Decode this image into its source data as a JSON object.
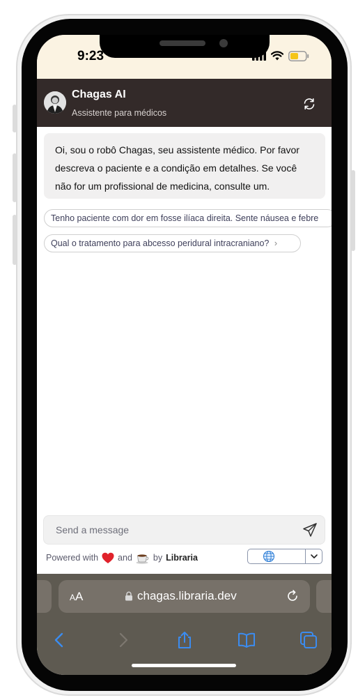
{
  "status_bar": {
    "time": "9:23"
  },
  "header": {
    "title": "Chagas AI",
    "subtitle": "Assistente para médicos"
  },
  "chat": {
    "bot_message_lines": [
      "Oi, sou o robô Chagas, seu assistente médico. Por favor",
      "descreva o paciente e a condição em detalhes. Se você",
      "não for um profissional de medicina, consulte um."
    ],
    "suggestions": [
      "Tenho paciente com dor em fosse ilíaca direita. Sente náusea e febre",
      "Qual o tratamento para abcesso peridural intracraniano?"
    ]
  },
  "composer": {
    "placeholder": "Send a message"
  },
  "footer": {
    "powered_prefix": "Powered with",
    "and_text": "and",
    "by_text": "by",
    "brand": "Libraria"
  },
  "browser": {
    "text_size_label": "AA",
    "url": "chagas.libraria.dev"
  },
  "colors": {
    "header_bg": "#332a29",
    "status_bar_bg": "#fbf3e2",
    "browser_bar_bg": "#5e5a51",
    "link_blue": "#2f80ed"
  },
  "icons": {
    "reset": "refresh-icon",
    "send": "paper-plane-icon",
    "language": "globe-icon",
    "heart": "heart-icon",
    "coffee": "coffee-icon"
  }
}
